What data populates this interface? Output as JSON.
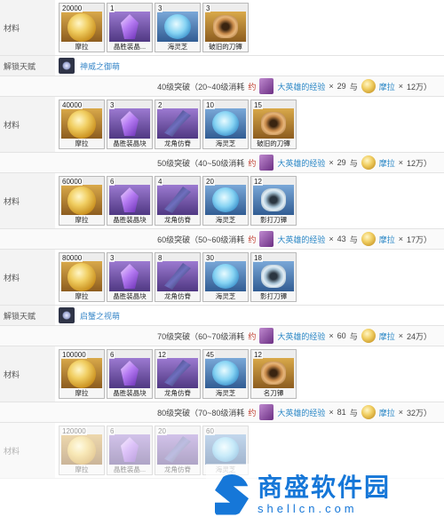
{
  "labels": {
    "materials": "材料",
    "unlock_talent": "解锁天赋"
  },
  "cost_common": {
    "approx": "约",
    "hero_exp": "大英雄的经验",
    "times": "×",
    "and": "与",
    "mora": "摩拉",
    "times2": "×"
  },
  "sections": [
    {
      "materials": [
        {
          "count": "20000",
          "name": "摩拉",
          "art": "coin",
          "bg": "gold"
        },
        {
          "count": "1",
          "name": "晶胜装晶...",
          "art": "crystal",
          "bg": "purple"
        },
        {
          "count": "3",
          "name": "海灵芝",
          "art": "flower",
          "bg": "blue"
        },
        {
          "count": "3",
          "name": "破旧的刀镡",
          "art": "guard",
          "bg": "gold"
        }
      ],
      "talent": {
        "name": "神威之御萌"
      },
      "cost": {
        "level": "40级突破（20~40级消耗",
        "exp_count": "29",
        "mora_count": "12万）"
      }
    },
    {
      "materials": [
        {
          "count": "40000",
          "name": "摩拉",
          "art": "coin",
          "bg": "gold"
        },
        {
          "count": "3",
          "name": "晶胜装晶块",
          "art": "crystal",
          "bg": "purple"
        },
        {
          "count": "2",
          "name": "龙角仿脊",
          "art": "feather",
          "bg": "purple"
        },
        {
          "count": "10",
          "name": "海灵芝",
          "art": "flower",
          "bg": "blue"
        },
        {
          "count": "15",
          "name": "破旧的刀镡",
          "art": "guard",
          "bg": "gold"
        }
      ],
      "cost": {
        "level": "50级突破（40~50级消耗",
        "exp_count": "29",
        "mora_count": "12万）"
      }
    },
    {
      "materials": [
        {
          "count": "60000",
          "name": "摩拉",
          "art": "coin",
          "bg": "gold"
        },
        {
          "count": "6",
          "name": "晶胜装晶块",
          "art": "crystal",
          "bg": "purple"
        },
        {
          "count": "4",
          "name": "龙角仿脊",
          "art": "feather",
          "bg": "purple"
        },
        {
          "count": "20",
          "name": "海灵芝",
          "art": "flower",
          "bg": "blue"
        },
        {
          "count": "12",
          "name": "影打刀镡",
          "art": "guard2",
          "bg": "blue"
        }
      ],
      "cost": {
        "level": "60级突破（50~60级消耗",
        "exp_count": "43",
        "mora_count": "17万）"
      }
    },
    {
      "materials": [
        {
          "count": "80000",
          "name": "摩拉",
          "art": "coin",
          "bg": "gold"
        },
        {
          "count": "3",
          "name": "晶胜装晶块",
          "art": "crystal",
          "bg": "purple"
        },
        {
          "count": "8",
          "name": "龙角仿脊",
          "art": "feather",
          "bg": "purple"
        },
        {
          "count": "30",
          "name": "海灵芝",
          "art": "flower",
          "bg": "blue"
        },
        {
          "count": "18",
          "name": "影打刀镡",
          "art": "guard2",
          "bg": "blue"
        }
      ],
      "talent": {
        "name": "启蟹之视萌"
      },
      "cost": {
        "level": "70级突破（60~70级消耗",
        "exp_count": "60",
        "mora_count": "24万）"
      }
    },
    {
      "materials": [
        {
          "count": "100000",
          "name": "摩拉",
          "art": "coin",
          "bg": "gold"
        },
        {
          "count": "6",
          "name": "晶胜装晶块",
          "art": "crystal",
          "bg": "purple"
        },
        {
          "count": "12",
          "name": "龙角仿脊",
          "art": "feather",
          "bg": "purple"
        },
        {
          "count": "45",
          "name": "海灵芝",
          "art": "flower",
          "bg": "blue"
        },
        {
          "count": "12",
          "name": "名刀镡",
          "art": "guard",
          "bg": "gold"
        }
      ],
      "cost": {
        "level": "80级突破（70~80级消耗",
        "exp_count": "81",
        "mora_count": "32万）"
      }
    },
    {
      "materials": [
        {
          "count": "120000",
          "name": "摩拉",
          "art": "coin",
          "bg": "gold"
        },
        {
          "count": "6",
          "name": "晶胜装晶...",
          "art": "crystal",
          "bg": "purple"
        },
        {
          "count": "20",
          "name": "龙角仿脊",
          "art": "feather",
          "bg": "purple"
        },
        {
          "count": "60",
          "name": "海灵芝",
          "art": "flower",
          "bg": "blue"
        }
      ],
      "faded": true
    }
  ],
  "watermark": {
    "title": "商盛软件园",
    "url": "shellcn.com",
    "color": "#1677d8"
  }
}
